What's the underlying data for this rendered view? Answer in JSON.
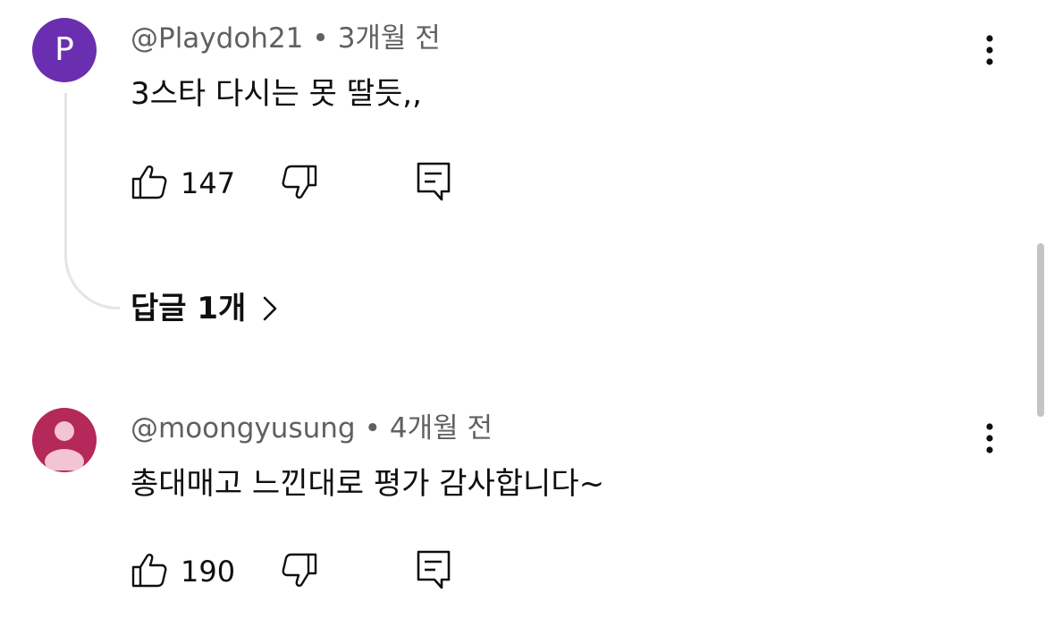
{
  "comments": [
    {
      "avatar_letter": "P",
      "avatar_color": "#6a2fb0",
      "author": "@Playdoh21",
      "separator": "•",
      "time": "3개월 전",
      "text": "3스타 다시는 못 딸듯,,",
      "likes": "147",
      "replies_label": "답글 1개"
    },
    {
      "avatar_color": "#b4285a",
      "author": "@moongyusung",
      "separator": "•",
      "time": "4개월 전",
      "text": "총대매고 느낀대로 평가 감사합니다~",
      "likes": "190"
    }
  ],
  "icons": {
    "like": "thumbs-up-icon",
    "dislike": "thumbs-down-icon",
    "reply": "comment-reply-icon",
    "more": "vertical-dots-icon",
    "chevron": "chevron-right-icon"
  },
  "colors": {
    "text_primary": "#0f0f0f",
    "text_secondary": "#606060",
    "thread_line": "#e5e5e5",
    "scrollbar": "#c4c4c4"
  }
}
